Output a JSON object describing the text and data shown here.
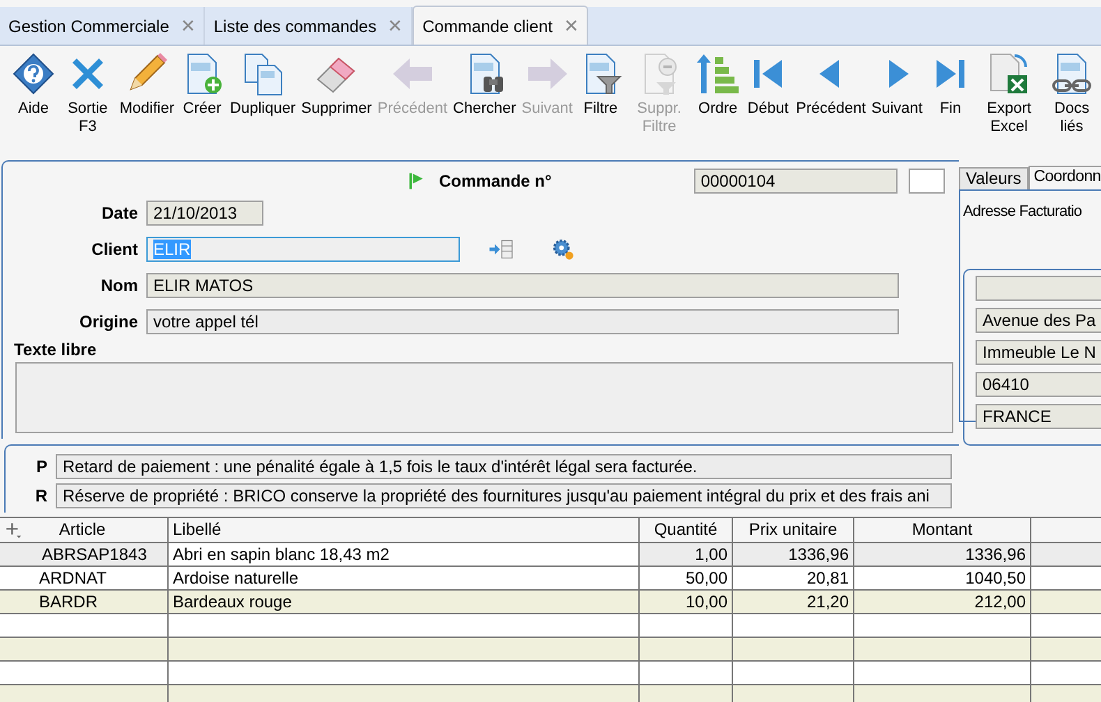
{
  "tabs": [
    {
      "label": "Gestion Commerciale",
      "selected": false,
      "close": "✕"
    },
    {
      "label": "Liste des commandes",
      "selected": false,
      "close": "✕"
    },
    {
      "label": "Commande client",
      "selected": true,
      "close": "✕"
    }
  ],
  "toolbar": [
    {
      "kind": "help",
      "label": "Aide",
      "disabled": false
    },
    {
      "kind": "exit",
      "label": "Sortie F3",
      "disabled": false
    },
    {
      "kind": "edit",
      "label": "Modifier",
      "disabled": false
    },
    {
      "kind": "create",
      "label": "Créer",
      "disabled": false
    },
    {
      "kind": "duplicate",
      "label": "Dupliquer",
      "disabled": false
    },
    {
      "kind": "delete",
      "label": "Supprimer",
      "disabled": false
    },
    {
      "kind": "bigleft",
      "label": "Précédent",
      "disabled": true
    },
    {
      "kind": "search",
      "label": "Chercher",
      "disabled": false
    },
    {
      "kind": "bigright",
      "label": "Suivant",
      "disabled": true
    },
    {
      "kind": "filter",
      "label": "Filtre",
      "disabled": false
    },
    {
      "kind": "unfilter",
      "label": "Suppr. Filtre",
      "disabled": true
    },
    {
      "kind": "order",
      "label": "Ordre",
      "disabled": false
    },
    {
      "kind": "first",
      "label": "Début",
      "disabled": false
    },
    {
      "kind": "prev",
      "label": "Précédent",
      "disabled": false
    },
    {
      "kind": "next",
      "label": "Suivant",
      "disabled": false
    },
    {
      "kind": "last",
      "label": "Fin",
      "disabled": false
    },
    {
      "kind": "excel",
      "label": "Export Excel",
      "disabled": false
    },
    {
      "kind": "links",
      "label": "Docs liés",
      "disabled": false
    }
  ],
  "order": {
    "label": "Commande n°",
    "number": "00000104"
  },
  "fields": [
    {
      "kind": "short",
      "label": "Date",
      "value": "21/10/2013"
    },
    {
      "kind": "client",
      "label": "Client",
      "value": "ELIR",
      "selected": true
    },
    {
      "kind": "wide",
      "label": "Nom",
      "value": "ELIR MATOS"
    },
    {
      "kind": "wide",
      "label": "Origine",
      "value": "votre appel tél"
    }
  ],
  "free_text": {
    "label": "Texte libre"
  },
  "terms": [
    {
      "code": "P",
      "text": "Retard de paiement : une pénalité égale à 1,5 fois le taux d'intérêt légal sera facturée."
    },
    {
      "code": "R",
      "text": "Réserve de propriété : BRICO conserve la propriété des fournitures jusqu'au paiement intégral du prix et des frais ani"
    }
  ],
  "side_tabs": [
    {
      "label": "Valeurs",
      "selected": false
    },
    {
      "label": "Coordonn",
      "selected": true
    }
  ],
  "side_subtab": {
    "label": "Adresse Facturatio"
  },
  "address": [
    {
      "kind": "blank"
    },
    {
      "kind": "text",
      "value": "Avenue des Pa"
    },
    {
      "kind": "text",
      "value": "Immeuble Le N"
    },
    {
      "kind": "text",
      "value": "06410"
    },
    {
      "kind": "text",
      "value": "FRANCE"
    }
  ],
  "table": {
    "columns": [
      "Article",
      "Libellé",
      "Quantité",
      "Prix unitaire",
      "Montant"
    ],
    "rows": [
      {
        "selected": true,
        "cells": [
          "ABRSAP1843",
          "Abri en sapin blanc 18,43 m2",
          "1,00",
          "1336,96",
          "1336,96"
        ]
      },
      {
        "selected": false,
        "cells": [
          "ARDNAT",
          "Ardoise naturelle",
          "50,00",
          "20,81",
          "1040,50"
        ]
      },
      {
        "selected": false,
        "cells": [
          "BARDR",
          "Bardeaux rouge",
          "10,00",
          "21,20",
          "212,00"
        ]
      }
    ]
  }
}
